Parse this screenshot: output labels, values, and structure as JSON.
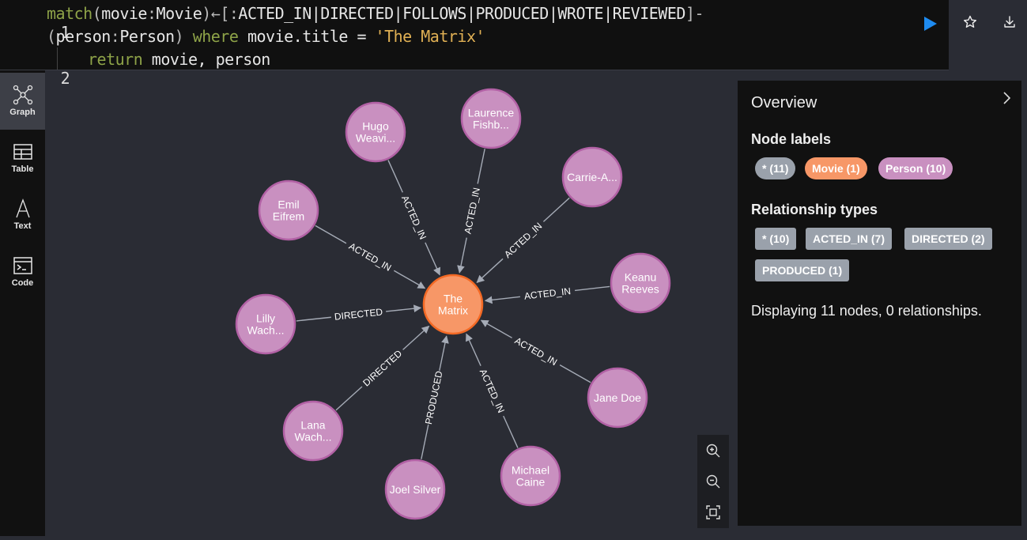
{
  "editor": {
    "line1_num": "1",
    "line2_num": "2",
    "tokens": {
      "match": "match",
      "open1": "(",
      "movie_var": "movie",
      "colon1": ":",
      "movie_label": "Movie",
      "close1": ")",
      "arrow": "←[:",
      "rel_types": "ACTED_IN|DIRECTED|FOLLOWS|PRODUCED|WROTE|REVIEWED",
      "rel_end": "]-",
      "open2": "(",
      "person_var": "person",
      "colon2": ":",
      "person_label": "Person",
      "close2": ")",
      "where": "where",
      "cond": "movie.title = ",
      "title_str": "'The Matrix'",
      "return_kw": "return",
      "return_vals": "movie, person"
    },
    "run_icon": "play-icon"
  },
  "toolbar": {
    "favorite_icon": "star-icon",
    "download_icon": "download-icon"
  },
  "sidebar": {
    "items": [
      {
        "label": "Graph",
        "icon": "graph-icon",
        "active": true
      },
      {
        "label": "Table",
        "icon": "table-icon",
        "active": false
      },
      {
        "label": "Text",
        "icon": "text-icon",
        "active": false
      },
      {
        "label": "Code",
        "icon": "code-icon",
        "active": false
      }
    ]
  },
  "graph": {
    "colors": {
      "movie": "#f79767",
      "person": "#c990c0",
      "edge": "#a5abb6"
    },
    "center": {
      "label": [
        "The",
        "Matrix"
      ]
    },
    "nodes": [
      {
        "label": [
          "Hugo",
          "Weavi..."
        ],
        "rel": "ACTED_IN"
      },
      {
        "label": [
          "Laurence",
          "Fishb..."
        ],
        "rel": "ACTED_IN"
      },
      {
        "label": [
          "Carrie-A..."
        ],
        "rel": "ACTED_IN"
      },
      {
        "label": [
          "Emil",
          "Eifrem"
        ],
        "rel": "ACTED_IN"
      },
      {
        "label": [
          "Keanu",
          "Reeves"
        ],
        "rel": "ACTED_IN"
      },
      {
        "label": [
          "Lilly",
          "Wach..."
        ],
        "rel": "DIRECTED"
      },
      {
        "label": [
          "Jane Doe"
        ],
        "rel": "ACTED_IN"
      },
      {
        "label": [
          "Lana",
          "Wach..."
        ],
        "rel": "DIRECTED"
      },
      {
        "label": [
          "Joel Silver"
        ],
        "rel": "PRODUCED"
      },
      {
        "label": [
          "Michael",
          "Caine"
        ],
        "rel": "ACTED_IN"
      }
    ]
  },
  "zoom": {
    "in_icon": "zoom-in-icon",
    "out_icon": "zoom-out-icon",
    "fit_icon": "fit-view-icon"
  },
  "overview": {
    "title": "Overview",
    "node_labels_heading": "Node labels",
    "node_labels": [
      {
        "text": "* (11)",
        "color": "#9aa1ab"
      },
      {
        "text": "Movie (1)",
        "color": "#f79767"
      },
      {
        "text": "Person (10)",
        "color": "#c990c0"
      }
    ],
    "rel_types_heading": "Relationship types",
    "rel_types": [
      "* (10)",
      "ACTED_IN (7)",
      "DIRECTED (2)",
      "PRODUCED (1)"
    ],
    "status": "Displaying 11 nodes, 0 relationships."
  }
}
